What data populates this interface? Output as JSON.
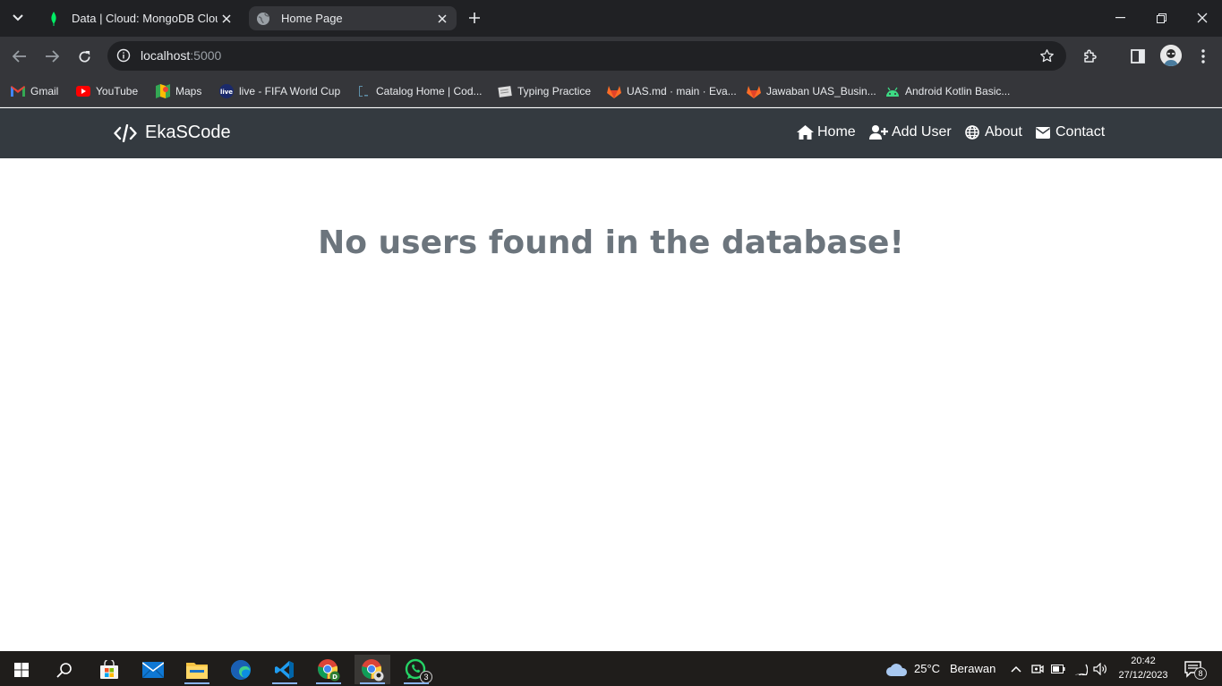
{
  "browser": {
    "tabs": [
      {
        "title": "Data | Cloud: MongoDB Cloud",
        "active": false
      },
      {
        "title": "Home Page",
        "active": true
      }
    ],
    "address": {
      "host": "localhost",
      "port": ":5000"
    },
    "bookmarks": [
      {
        "label": "Gmail",
        "icon": "gmail-icon"
      },
      {
        "label": "YouTube",
        "icon": "youtube-icon"
      },
      {
        "label": "Maps",
        "icon": "maps-icon"
      },
      {
        "label": "live - FIFA World Cup",
        "icon": "live-icon"
      },
      {
        "label": "Catalog Home | Cod...",
        "icon": "catalog-icon"
      },
      {
        "label": "Typing Practice",
        "icon": "typing-icon"
      },
      {
        "label": "UAS.md · main · Eva...",
        "icon": "gitlab-icon"
      },
      {
        "label": "Jawaban UAS_Busin...",
        "icon": "gitlab-icon"
      },
      {
        "label": "Android Kotlin Basic...",
        "icon": "android-icon"
      }
    ]
  },
  "site": {
    "brand": "EkaSCode",
    "nav": [
      {
        "label": "Home",
        "icon": "home-icon"
      },
      {
        "label": "Add User",
        "icon": "user-plus-icon"
      },
      {
        "label": "About",
        "icon": "globe-icon"
      },
      {
        "label": "Contact",
        "icon": "envelope-icon"
      }
    ],
    "message": "No users found in the database!"
  },
  "taskbar": {
    "weather": {
      "temp": "25°C",
      "condition": "Berawan"
    },
    "time": "20:42",
    "date": "27/12/2023",
    "whatsapp_badge": "3",
    "notification_count": "8",
    "colors": {
      "accent": "#8ab4f8",
      "navbar": "#343a40",
      "message": "#6c757d"
    }
  }
}
